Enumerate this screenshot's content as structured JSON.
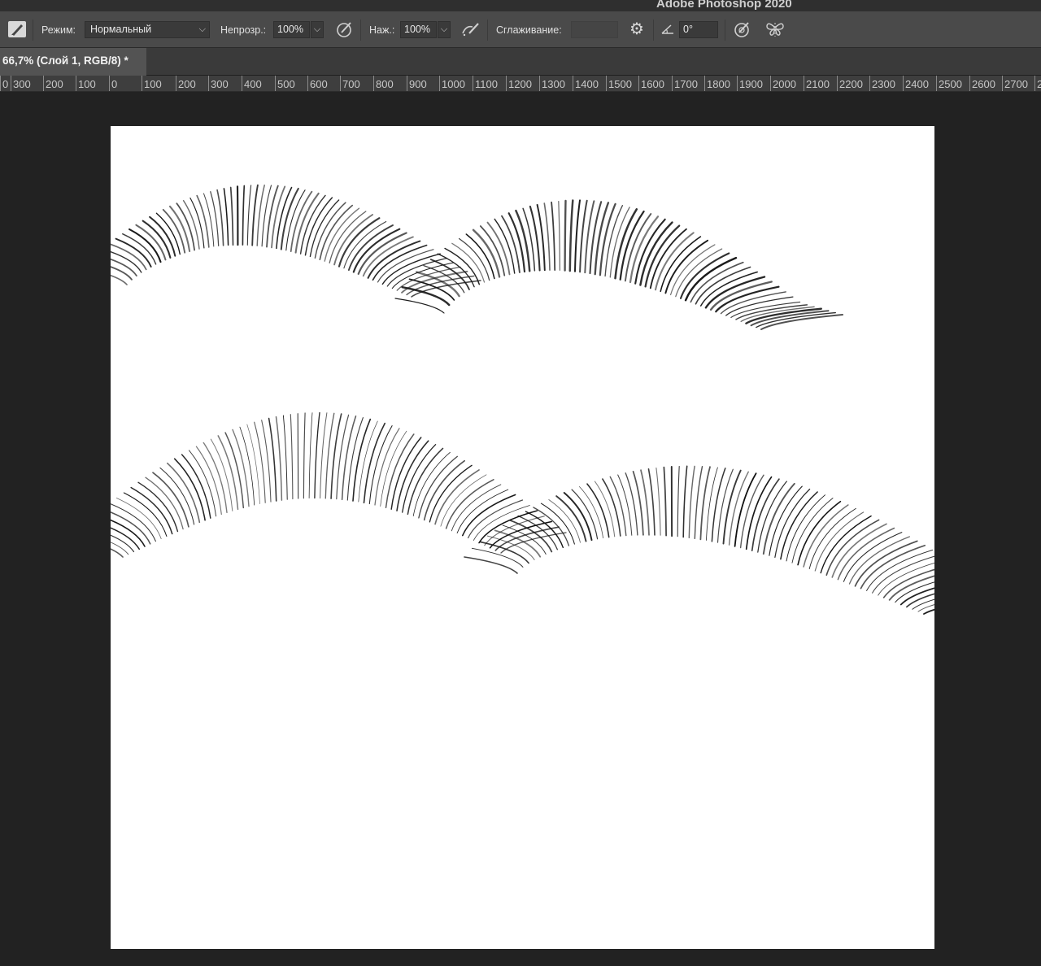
{
  "window": {
    "title": "Adobe Photoshop 2020"
  },
  "options_bar": {
    "mode_label": "Режим:",
    "mode_value": "Нормальный",
    "opacity_label": "Непрозр.:",
    "opacity_value": "100%",
    "flow_label": "Наж.:",
    "flow_value": "100%",
    "smoothing_label": "Сглаживание:",
    "smoothing_value": "",
    "angle_value": "0°"
  },
  "document_tab": {
    "label": "66,7% (Слой 1, RGB/8) *"
  },
  "ruler": {
    "labels": [
      "0",
      "300",
      "200",
      "100",
      "0",
      "100",
      "200",
      "300",
      "400",
      "500",
      "600",
      "700",
      "800",
      "900",
      "1000",
      "1100",
      "1200",
      "1300",
      "1400",
      "1500",
      "1600",
      "1700",
      "1800",
      "1900",
      "2000",
      "2100",
      "2200",
      "2300",
      "2400",
      "2500",
      "2600",
      "2700",
      "2"
    ]
  },
  "canvas": {
    "background": "#ffffff",
    "content": "eyelash brush strokes"
  },
  "colors": {
    "app_bg": "#222222",
    "options_bg": "#4a4a4a",
    "tab_active": "#535353",
    "ruler_bg": "#3e3e3e"
  }
}
